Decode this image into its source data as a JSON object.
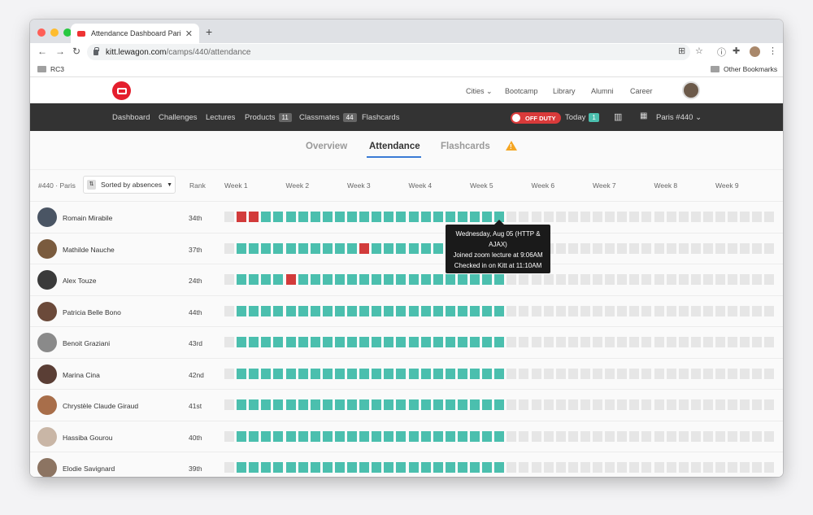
{
  "browser": {
    "tab_title": "Attendance Dashboard Paris #",
    "url_host": "kitt.lewagon.com",
    "url_path": "/camps/440/attendance",
    "bookmark_left": "RC3",
    "bookmark_right": "Other Bookmarks",
    "colors": {
      "close": "#ff5f57",
      "minimize": "#febc2e",
      "maximize": "#28c840"
    }
  },
  "site_nav": {
    "links": [
      "Cities",
      "Bootcamp",
      "Library",
      "Alumni",
      "Career"
    ]
  },
  "app_nav": {
    "items": [
      "Dashboard",
      "Challenges",
      "Lectures",
      "Products",
      "Classmates",
      "Flashcards"
    ],
    "products_count": "11",
    "classmates_count": "44",
    "duty_label": "OFF DUTY",
    "today_label": "Today",
    "today_count": "1",
    "camp_label": "Paris #440"
  },
  "tabs": {
    "overview": "Overview",
    "attendance": "Attendance",
    "flashcards": "Flashcards"
  },
  "table": {
    "camp": "#440 · Paris",
    "sort_label": "Sorted by absences",
    "rank_header": "Rank",
    "weeks": [
      "Week 1",
      "Week 2",
      "Week 3",
      "Week 4",
      "Week 5",
      "Week 6",
      "Week 7",
      "Week 8",
      "Week 9"
    ],
    "status_colors": {
      "present": "#4bbfae",
      "absent": "#d23b3b",
      "future": "#e6e6e6"
    },
    "students": [
      {
        "name": "Romain Mirabile",
        "rank": "34th",
        "absences": [
          1,
          2
        ],
        "avatar_color": "#4a5564"
      },
      {
        "name": "Mathilde Nauche",
        "rank": "37th",
        "absences": [
          11
        ],
        "avatar_color": "#7a5b3e"
      },
      {
        "name": "Alex Touze",
        "rank": "24th",
        "absences": [
          5
        ],
        "avatar_color": "#3a3a3a"
      },
      {
        "name": "Patricia Belle Bono",
        "rank": "44th",
        "absences": [],
        "avatar_color": "#6b4a3a"
      },
      {
        "name": "Benoit Graziani",
        "rank": "43rd",
        "absences": [],
        "avatar_color": "#8a8a8a"
      },
      {
        "name": "Marina Cina",
        "rank": "42nd",
        "absences": [],
        "avatar_color": "#5a3e35"
      },
      {
        "name": "Chrystèle Claude Giraud",
        "rank": "41st",
        "absences": [],
        "avatar_color": "#a86e4a"
      },
      {
        "name": "Hassiba Gourou",
        "rank": "40th",
        "absences": [],
        "avatar_color": "#c9b6a6"
      },
      {
        "name": "Elodie Savignard",
        "rank": "39th",
        "absences": [],
        "avatar_color": "#8c7462"
      }
    ]
  },
  "tooltip": {
    "line1": "Wednesday, Aug 05 (HTTP &",
    "line2": "AJAX)",
    "line3": "Joined zoom lecture at 9:06AM",
    "line4": "Checked in on Kitt at 11:10AM"
  }
}
